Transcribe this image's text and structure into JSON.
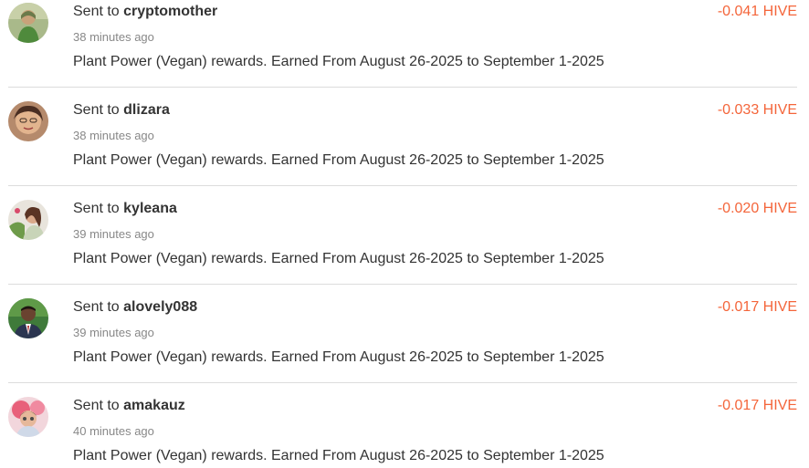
{
  "transactions": [
    {
      "prefix": "Sent to",
      "username": "cryptomother",
      "time": "38 minutes ago",
      "memo": "Plant Power (Vegan) rewards. Earned From August 26-2025 to September 1-2025",
      "amount": "-0.041 HIVE"
    },
    {
      "prefix": "Sent to",
      "username": "dlizara",
      "time": "38 minutes ago",
      "memo": "Plant Power (Vegan) rewards. Earned From August 26-2025 to September 1-2025",
      "amount": "-0.033 HIVE"
    },
    {
      "prefix": "Sent to",
      "username": "kyleana",
      "time": "39 minutes ago",
      "memo": "Plant Power (Vegan) rewards. Earned From August 26-2025 to September 1-2025",
      "amount": "-0.020 HIVE"
    },
    {
      "prefix": "Sent to",
      "username": "alovely088",
      "time": "39 minutes ago",
      "memo": "Plant Power (Vegan) rewards. Earned From August 26-2025 to September 1-2025",
      "amount": "-0.017 HIVE"
    },
    {
      "prefix": "Sent to",
      "username": "amakauz",
      "time": "40 minutes ago",
      "memo": "Plant Power (Vegan) rewards. Earned From August 26-2025 to September 1-2025",
      "amount": "-0.017 HIVE"
    }
  ],
  "colors": {
    "amount": "#f4653a",
    "text": "#333333",
    "muted": "#888888",
    "divider": "#dcdcdc"
  }
}
